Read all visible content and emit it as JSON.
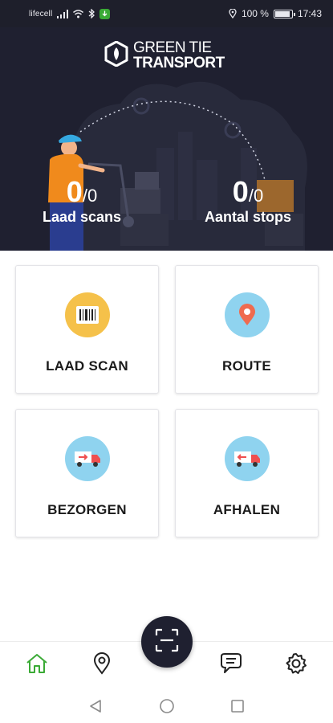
{
  "status_bar": {
    "carrier": "lifecell",
    "battery": "100 %",
    "time": "17:43"
  },
  "brand": {
    "line1": "GREEN TIE",
    "line2": "TRANSPORT"
  },
  "stats": {
    "scans": {
      "value": "0",
      "total": "/0",
      "label": "Laad scans"
    },
    "stops": {
      "value": "0",
      "total": "/0",
      "label": "Aantal stops"
    }
  },
  "tiles": [
    {
      "label": "LAAD SCAN",
      "icon": "barcode-icon",
      "color": "#f5c14a"
    },
    {
      "label": "ROUTE",
      "icon": "location-pin-icon",
      "color": "#8fd3ef"
    },
    {
      "label": "BEZORGEN",
      "icon": "delivery-truck-icon",
      "color": "#8fd3ef"
    },
    {
      "label": "AFHALEN",
      "icon": "pickup-truck-icon",
      "color": "#8fd3ef"
    }
  ],
  "bottom_nav": [
    "home-icon",
    "map-pin-icon",
    "scan-icon",
    "chat-icon",
    "settings-icon"
  ],
  "colors": {
    "header_bg": "#1f2030",
    "active_nav": "#3aaa35",
    "accent_orange": "#f08a1c"
  }
}
